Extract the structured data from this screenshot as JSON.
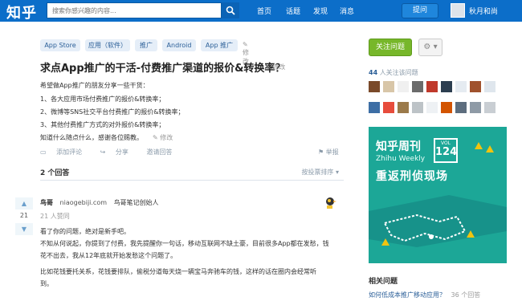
{
  "header": {
    "logo": "知乎",
    "search_placeholder": "搜索你感兴趣的内容...",
    "nav": [
      "首页",
      "话题",
      "发现",
      "消息"
    ],
    "ask_label": "提问",
    "user_name": "秋月和尚"
  },
  "question": {
    "tags": [
      "App Store",
      "应用（软件）",
      "推广",
      "Android",
      "App 推广"
    ],
    "modify_label": "修改",
    "title": "求点App推广的干活-付费推广渠道的报价&转换率？",
    "body_lines": [
      "希望做App推广的朋友分享一些干货：",
      "1、各大应用市场付费推广的报价&转换率；",
      "2、微博等SNS社交平台付费推广的报价&转换率；",
      "3、其他付费推广方式的对外报价&转换率；",
      "知道什么随点什么，感谢各位赐教。"
    ],
    "actions": [
      "添加评论",
      "分享",
      "邀请回答"
    ],
    "report_label": "举报"
  },
  "answers": {
    "count_label": "2 个回答",
    "sort_label": "按投票排序",
    "first": {
      "upvotes": "21",
      "author_name": "鸟哥",
      "author_blog": "niaogebiji.com",
      "author_bio": "鸟哥笔记创始人",
      "agree_text": "21 人赞同",
      "lines": [
        "看了你的问题，绝对是新手吧。",
        "不知从何说起，你提到了付费，我先提醒你一句话，移动互联网不缺土豪，目前很多App都在发愁，钱",
        "花不出去，我从12年底就开始发愁这个问题了。",
        "",
        "比如花钱要托关系，花钱要排队，偷税分道每天烧一辆宝马奔驰车的钱，这样的话在圈内会经常听",
        "到。"
      ]
    }
  },
  "sidebar": {
    "follow_label": "关注问题",
    "followers_count": "44",
    "followers_suffix": "人关注该问题",
    "promo": {
      "title": "知乎周刊",
      "subtitle": "Zhihu Weekly",
      "vol_label": "VOL",
      "vol_number": "124",
      "headline": "重返刑侦现场"
    },
    "related_title": "相关问题",
    "related_items": [
      {
        "text": "如何低成本推广移动应用？",
        "count": "36 个回答"
      }
    ]
  },
  "colors": {
    "header_blue": "#0c6ec9",
    "follow_green": "#77b72a",
    "promo_teal": "#1ca797",
    "link_blue": "#2b5f98"
  }
}
